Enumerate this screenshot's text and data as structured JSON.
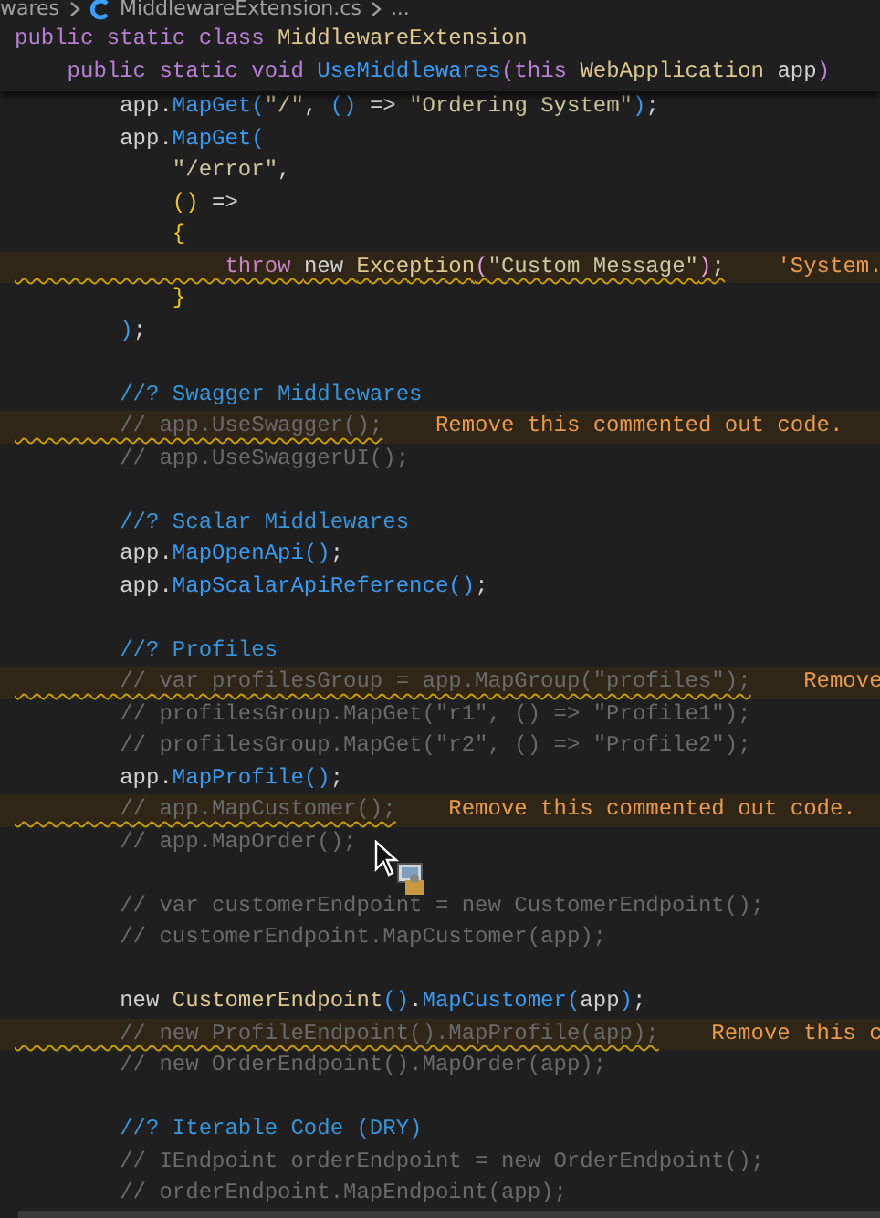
{
  "breadcrumb": {
    "items": [
      {
        "text": "wares",
        "kind": "folder"
      },
      {
        "text": "MiddlewareExtension.cs",
        "kind": "file"
      },
      {
        "text": "...",
        "kind": "more"
      }
    ]
  },
  "sticky": [
    {
      "tokens": [
        {
          "text": "public static class ",
          "kind": "kw"
        },
        {
          "text": "MiddlewareExtension",
          "kind": "type"
        }
      ]
    },
    {
      "tokens": [
        {
          "text": "    public static void ",
          "kind": "kw"
        },
        {
          "text": "UseMiddlewares",
          "kind": "method"
        },
        {
          "text": "(",
          "kind": "kw"
        },
        {
          "text": "this ",
          "kind": "kw"
        },
        {
          "text": "WebApplication",
          "kind": "type"
        },
        {
          "text": " app",
          "kind": "plain"
        },
        {
          "text": ")",
          "kind": "kw"
        }
      ]
    }
  ],
  "lines": [
    {
      "kind": "code",
      "warning": false,
      "tokens": [
        {
          "text": "        app.",
          "kind": "plain"
        },
        {
          "text": "MapGet",
          "kind": "method"
        },
        {
          "text": "(",
          "kind": "paren"
        },
        {
          "text": "\"/\"",
          "kind": "string"
        },
        {
          "text": ", ",
          "kind": "plain"
        },
        {
          "text": "()",
          "kind": "paren"
        },
        {
          "text": " => ",
          "kind": "plain"
        },
        {
          "text": "\"Ordering System\"",
          "kind": "string"
        },
        {
          "text": ")",
          "kind": "paren"
        },
        {
          "text": ";",
          "kind": "plain"
        }
      ]
    },
    {
      "kind": "code",
      "warning": false,
      "tokens": [
        {
          "text": "        app.",
          "kind": "plain"
        },
        {
          "text": "MapGet",
          "kind": "method"
        },
        {
          "text": "(",
          "kind": "paren"
        }
      ]
    },
    {
      "kind": "code",
      "warning": false,
      "tokens": [
        {
          "text": "            \"/error\"",
          "kind": "string"
        },
        {
          "text": ",",
          "kind": "plain"
        }
      ]
    },
    {
      "kind": "code",
      "warning": false,
      "tokens": [
        {
          "text": "            ()",
          "kind": "bracket"
        },
        {
          "text": " =>",
          "kind": "plain"
        }
      ]
    },
    {
      "kind": "code",
      "warning": false,
      "tokens": [
        {
          "text": "            {",
          "kind": "bracket"
        }
      ]
    },
    {
      "kind": "code",
      "warning": true,
      "hint": "'System.",
      "tokens": [
        {
          "text": "                throw ",
          "kind": "ctl"
        },
        {
          "text": "new ",
          "kind": "plain"
        },
        {
          "text": "Exception",
          "kind": "type"
        },
        {
          "text": "(",
          "kind": "bracket2"
        },
        {
          "text": "\"Custom Message\"",
          "kind": "string"
        },
        {
          "text": ")",
          "kind": "bracket2"
        },
        {
          "text": ";",
          "kind": "plain"
        }
      ]
    },
    {
      "kind": "code",
      "warning": false,
      "tokens": [
        {
          "text": "            }",
          "kind": "bracket"
        }
      ]
    },
    {
      "kind": "code",
      "warning": false,
      "tokens": [
        {
          "text": "        )",
          "kind": "paren"
        },
        {
          "text": ";",
          "kind": "plain"
        }
      ]
    },
    {
      "kind": "blank"
    },
    {
      "kind": "code",
      "warning": false,
      "tokens": [
        {
          "text": "        //? Swagger Middlewares",
          "kind": "note"
        }
      ]
    },
    {
      "kind": "code",
      "warning": true,
      "hint": "Remove this commented out code.",
      "tokens": [
        {
          "text": "        // app.UseSwagger();",
          "kind": "comment"
        }
      ]
    },
    {
      "kind": "code",
      "warning": false,
      "tokens": [
        {
          "text": "        // app.UseSwaggerUI();",
          "kind": "comment"
        }
      ]
    },
    {
      "kind": "blank"
    },
    {
      "kind": "code",
      "warning": false,
      "tokens": [
        {
          "text": "        //? Scalar Middlewares",
          "kind": "note"
        }
      ]
    },
    {
      "kind": "code",
      "warning": false,
      "tokens": [
        {
          "text": "        app.",
          "kind": "plain"
        },
        {
          "text": "MapOpenApi",
          "kind": "method"
        },
        {
          "text": "()",
          "kind": "paren"
        },
        {
          "text": ";",
          "kind": "plain"
        }
      ]
    },
    {
      "kind": "code",
      "warning": false,
      "tokens": [
        {
          "text": "        app.",
          "kind": "plain"
        },
        {
          "text": "MapScalarApiReference",
          "kind": "method"
        },
        {
          "text": "()",
          "kind": "paren"
        },
        {
          "text": ";",
          "kind": "plain"
        }
      ]
    },
    {
      "kind": "blank"
    },
    {
      "kind": "code",
      "warning": false,
      "tokens": [
        {
          "text": "        //? Profiles",
          "kind": "note"
        }
      ]
    },
    {
      "kind": "code",
      "warning": true,
      "hint": "Remove",
      "tokens": [
        {
          "text": "        // var profilesGroup = app.MapGroup(\"profiles\");",
          "kind": "comment"
        }
      ]
    },
    {
      "kind": "code",
      "warning": false,
      "tokens": [
        {
          "text": "        // profilesGroup.MapGet(\"r1\", () => \"Profile1\");",
          "kind": "comment"
        }
      ]
    },
    {
      "kind": "code",
      "warning": false,
      "tokens": [
        {
          "text": "        // profilesGroup.MapGet(\"r2\", () => \"Profile2\");",
          "kind": "comment"
        }
      ]
    },
    {
      "kind": "code",
      "warning": false,
      "tokens": [
        {
          "text": "        app.",
          "kind": "plain"
        },
        {
          "text": "MapProfile",
          "kind": "method"
        },
        {
          "text": "()",
          "kind": "paren"
        },
        {
          "text": ";",
          "kind": "plain"
        }
      ]
    },
    {
      "kind": "code",
      "warning": true,
      "hint": "Remove this commented out code.",
      "tokens": [
        {
          "text": "        // app.MapCustomer();",
          "kind": "comment"
        }
      ]
    },
    {
      "kind": "code",
      "warning": false,
      "tokens": [
        {
          "text": "        // app.MapOrder();",
          "kind": "comment"
        }
      ]
    },
    {
      "kind": "blank"
    },
    {
      "kind": "code",
      "warning": false,
      "tokens": [
        {
          "text": "        // var customerEndpoint = new CustomerEndpoint();",
          "kind": "comment"
        }
      ]
    },
    {
      "kind": "code",
      "warning": false,
      "tokens": [
        {
          "text": "        // customerEndpoint.MapCustomer(app);",
          "kind": "comment"
        }
      ]
    },
    {
      "kind": "blank"
    },
    {
      "kind": "code",
      "warning": false,
      "tokens": [
        {
          "text": "        new ",
          "kind": "plain"
        },
        {
          "text": "CustomerEndpoint",
          "kind": "type"
        },
        {
          "text": "()",
          "kind": "paren"
        },
        {
          "text": ".",
          "kind": "plain"
        },
        {
          "text": "MapCustomer",
          "kind": "method"
        },
        {
          "text": "(",
          "kind": "paren"
        },
        {
          "text": "app",
          "kind": "plain"
        },
        {
          "text": ")",
          "kind": "paren"
        },
        {
          "text": ";",
          "kind": "plain"
        }
      ]
    },
    {
      "kind": "code",
      "warning": true,
      "hint": "Remove this c",
      "tokens": [
        {
          "text": "        // new ProfileEndpoint().MapProfile(app);",
          "kind": "comment"
        }
      ]
    },
    {
      "kind": "code",
      "warning": false,
      "tokens": [
        {
          "text": "        // new OrderEndpoint().MapOrder(app);",
          "kind": "comment"
        }
      ]
    },
    {
      "kind": "blank"
    },
    {
      "kind": "code",
      "warning": false,
      "tokens": [
        {
          "text": "        //? Iterable Code (DRY)",
          "kind": "note"
        }
      ]
    },
    {
      "kind": "code",
      "warning": false,
      "tokens": [
        {
          "text": "        // IEndpoint orderEndpoint = new OrderEndpoint();",
          "kind": "comment"
        }
      ]
    },
    {
      "kind": "code",
      "warning": false,
      "tokens": [
        {
          "text": "        // orderEndpoint.MapEndpoint(app);",
          "kind": "comment"
        }
      ]
    }
  ]
}
